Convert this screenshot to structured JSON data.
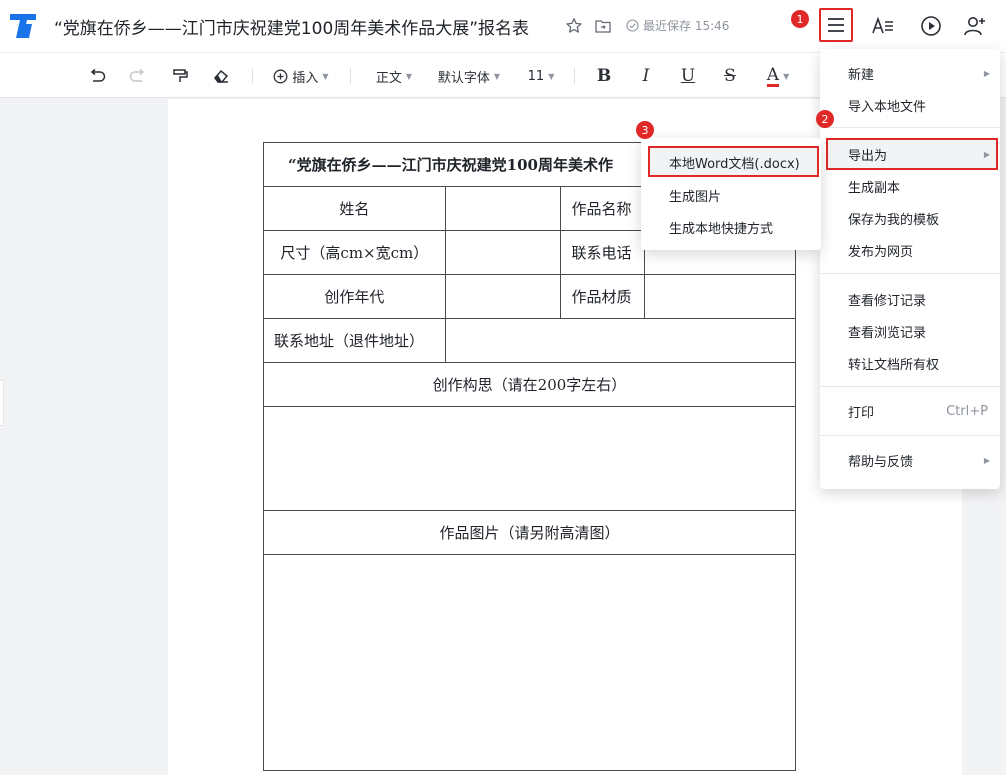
{
  "header": {
    "title": "“党旗在侨乡——江门市庆祝建党100周年美术作品大展”报名表",
    "save_status": "最近保存 15:46"
  },
  "toolbar": {
    "insert": "插入",
    "style": "正文",
    "font": "默认字体",
    "size": "11",
    "bold": "B",
    "italic": "I",
    "underline": "U",
    "strike": "S",
    "color": "A"
  },
  "form": {
    "title": "“党旗在侨乡——江门市庆祝建党100周年美术作",
    "name_label": "姓名",
    "work_name_label": "作品名称",
    "size_label": "尺寸（高cm×宽cm）",
    "phone_label": "联系电话",
    "year_label": "创作年代",
    "material_label": "作品材质",
    "address_label": "联系地址（退件地址）",
    "concept_label": "创作构思（请在200字左右）",
    "picture_label": "作品图片（请另附高清图）"
  },
  "main_menu": {
    "new": "新建",
    "import": "导入本地文件",
    "export": "导出为",
    "copy": "生成副本",
    "save_template": "保存为我的模板",
    "publish": "发布为网页",
    "revisions": "查看修订记录",
    "views": "查看浏览记录",
    "transfer": "转让文档所有权",
    "print": "打印",
    "print_shortcut": "Ctrl+P",
    "help": "帮助与反馈"
  },
  "sub_menu": {
    "docx": "本地Word文档(.docx)",
    "image": "生成图片",
    "shortcut": "生成本地快捷方式"
  },
  "badges": {
    "one": "1",
    "two": "2",
    "three": "3"
  },
  "colors": {
    "accent_red": "#e02828",
    "logo_blue": "#1a73e8"
  }
}
